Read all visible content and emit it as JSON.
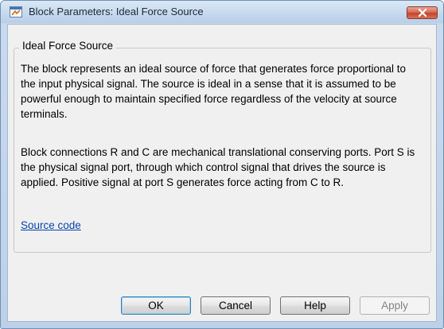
{
  "window": {
    "title": "Block Parameters: Ideal Force Source",
    "close_glyph": "✕",
    "icon": "simulink-block-icon"
  },
  "group": {
    "title": "Ideal Force Source",
    "description_1": "The block represents an ideal source of force that generates force proportional to the input physical signal. The source is ideal in a sense that it is assumed to be powerful enough to maintain specified force regardless of the velocity at source terminals.",
    "description_2": "Block connections R and C are mechanical translational conserving ports. Port S is the physical signal port, through which control signal that drives the source is applied. Positive signal at port S generates force acting from C to R.",
    "link": "Source code"
  },
  "buttons": {
    "ok": "OK",
    "cancel": "Cancel",
    "help": "Help",
    "apply": "Apply"
  },
  "colors": {
    "link": "#0645ad",
    "close_button": "#c1442c",
    "disabled_text": "#838383"
  }
}
